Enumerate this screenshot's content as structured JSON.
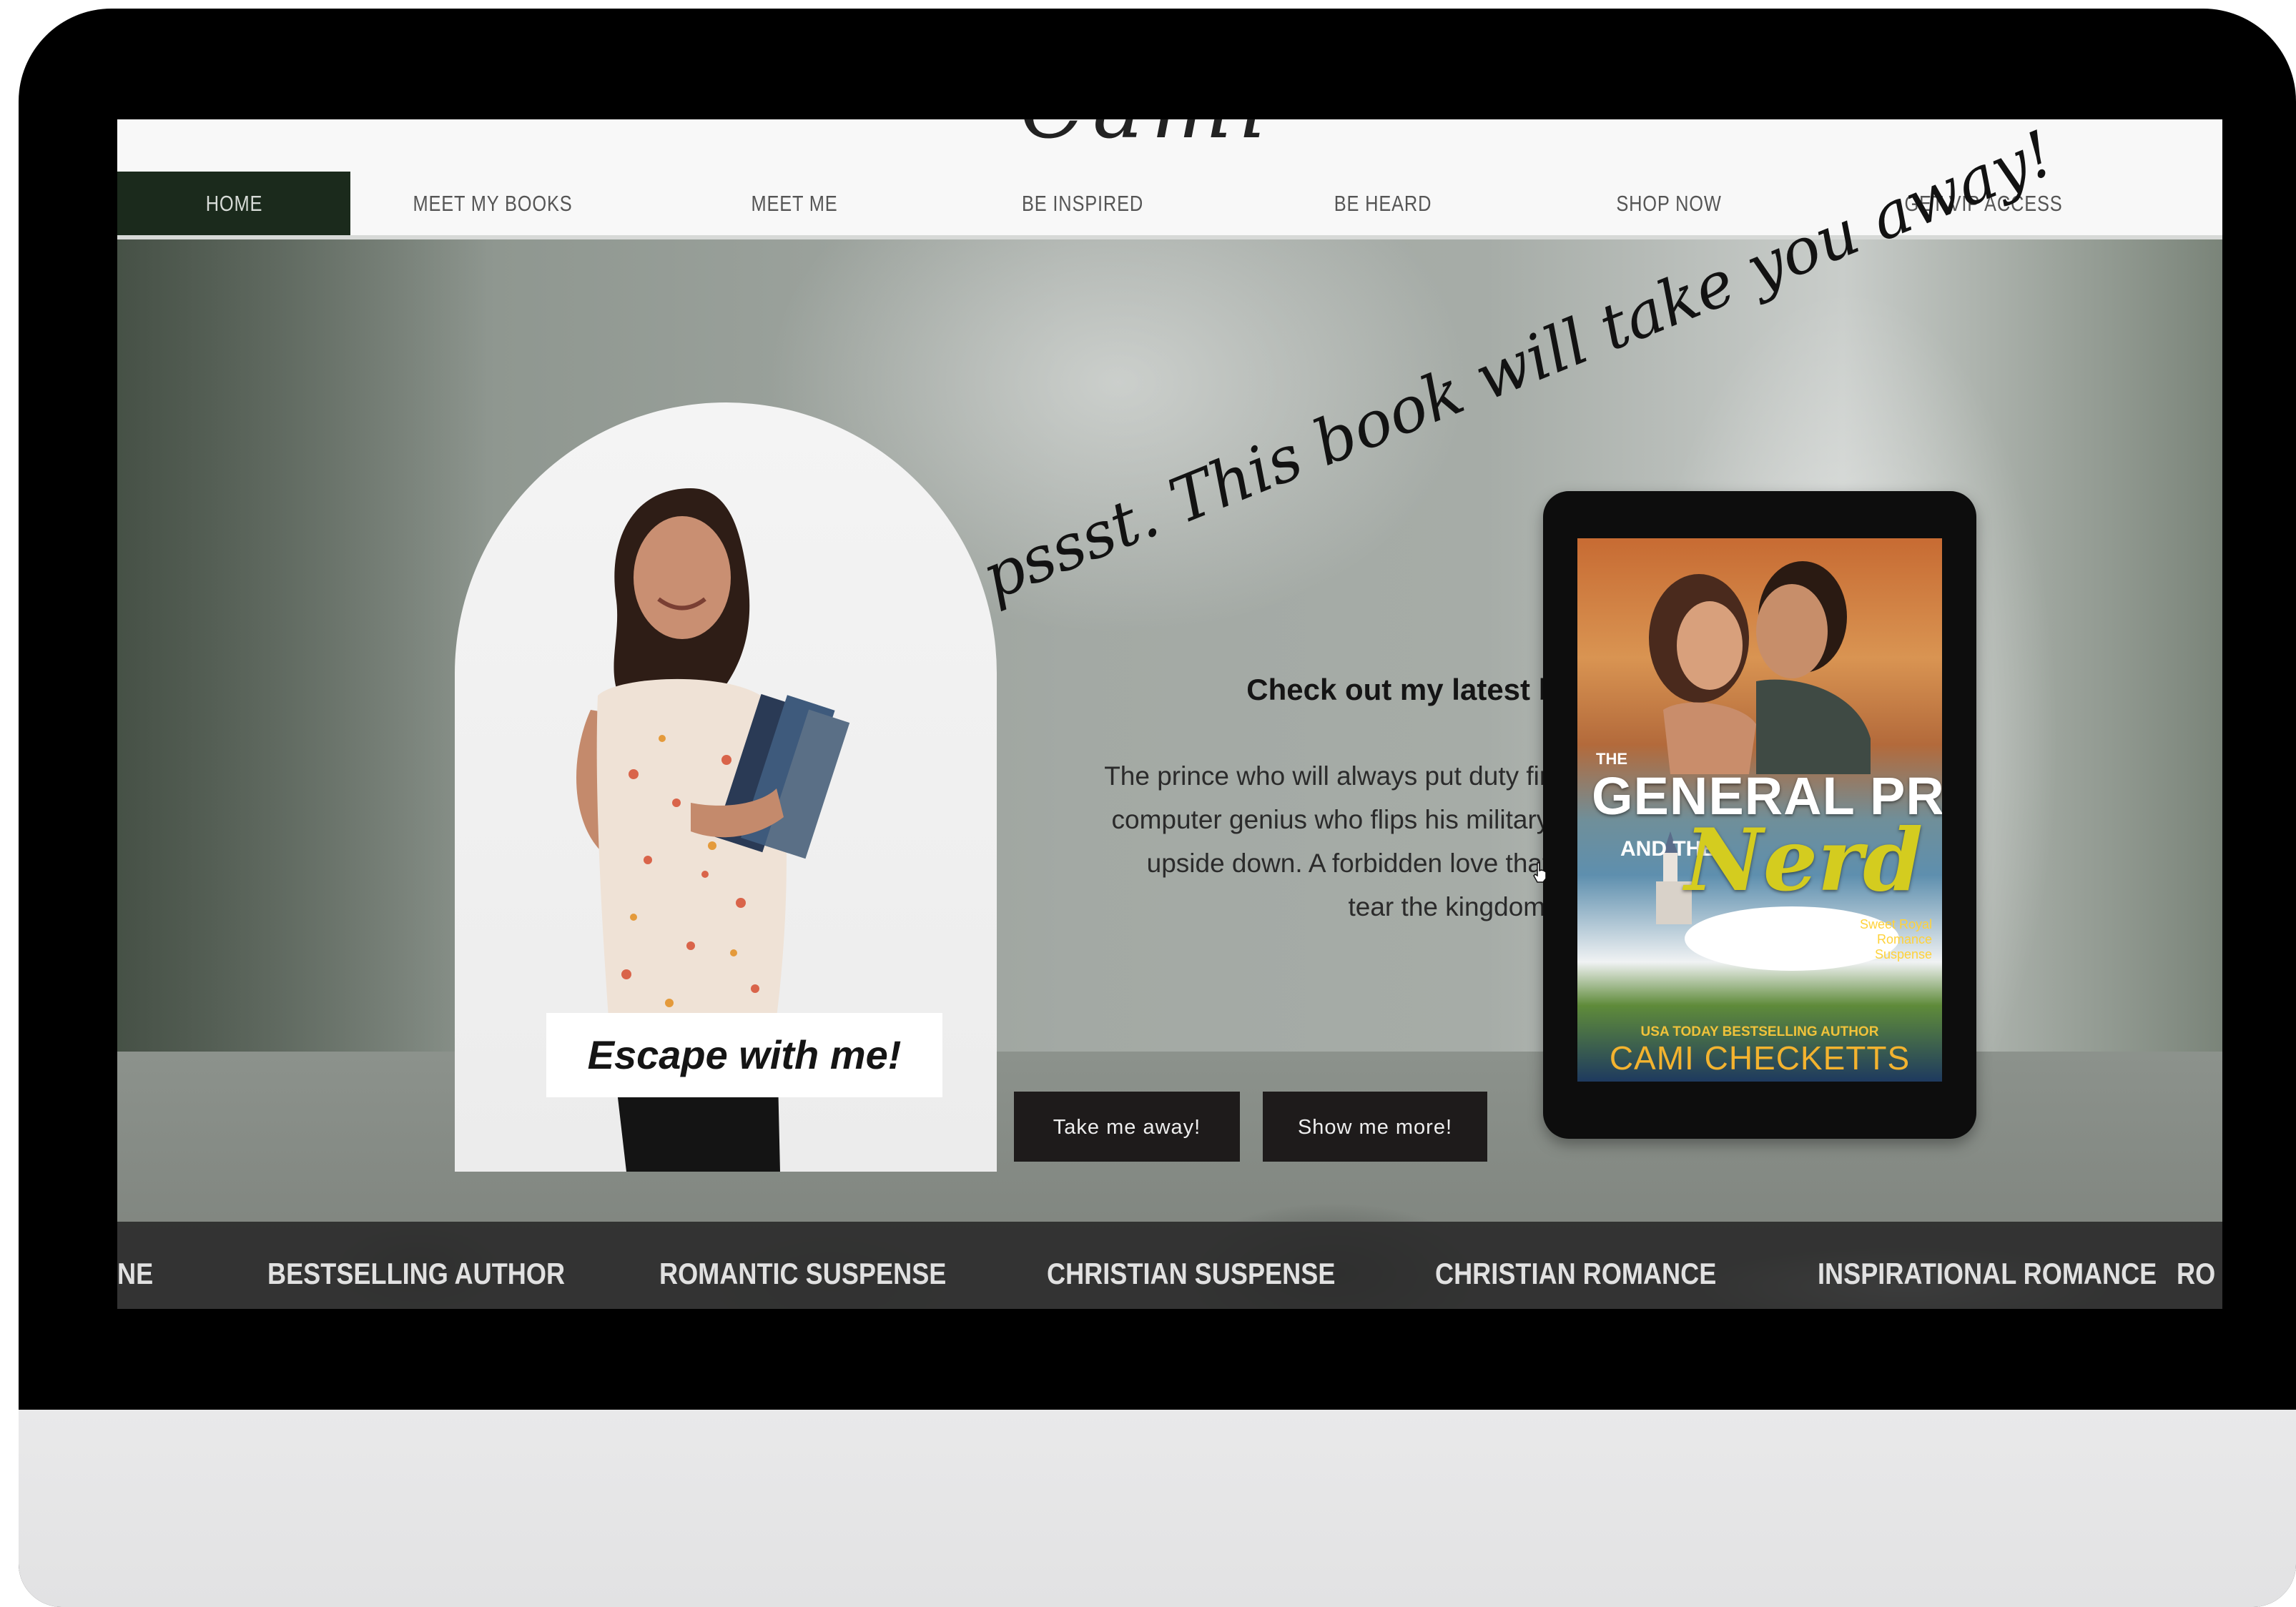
{
  "header": {
    "logo_text": "Cami Checketts"
  },
  "nav": {
    "items": [
      {
        "label": "HOME",
        "active": true
      },
      {
        "label": "MEET MY BOOKS"
      },
      {
        "label": "MEET ME"
      },
      {
        "label": "BE INSPIRED"
      },
      {
        "label": "BE HEARD"
      },
      {
        "label": "SHOP NOW"
      },
      {
        "label": "GET VIP ACCESS"
      }
    ]
  },
  "hero": {
    "script_heading": "pssst. This book will take you away!",
    "photo_caption": "Escape with me!",
    "latest_heading": "Check out my latest book:",
    "blurb": "The prince who will always put duty first; the computer genius who flips his military world upside down. A forbidden love that could tear the kingdom apart.",
    "buttons": {
      "take_me_away": "Take me away!",
      "show_me_more": "Show me more!"
    }
  },
  "book_cover": {
    "the": "THE",
    "title_line1": "GENERAL PRINCE",
    "and_the": "AND THE",
    "title_line2": "Nerd",
    "series": "Sweet Royal Romance Suspense",
    "tagline": "USA TODAY BESTSELLING AUTHOR",
    "author": "CAMI CHECKETTS"
  },
  "genre_band": {
    "items": [
      "NE",
      "BESTSELLING AUTHOR",
      "ROMANTIC SUSPENSE",
      "CHRISTIAN SUSPENSE",
      "CHRISTIAN ROMANCE",
      "INSPIRATIONAL ROMANCE",
      "RO"
    ]
  },
  "colors": {
    "nav_active_bg": "#1b2a1c",
    "button_bg": "#1e1b1b",
    "genre_band_bg": "#2d2c2c",
    "cover_title_accent": "#d4cc1f",
    "cover_author": "#f3b32f"
  }
}
